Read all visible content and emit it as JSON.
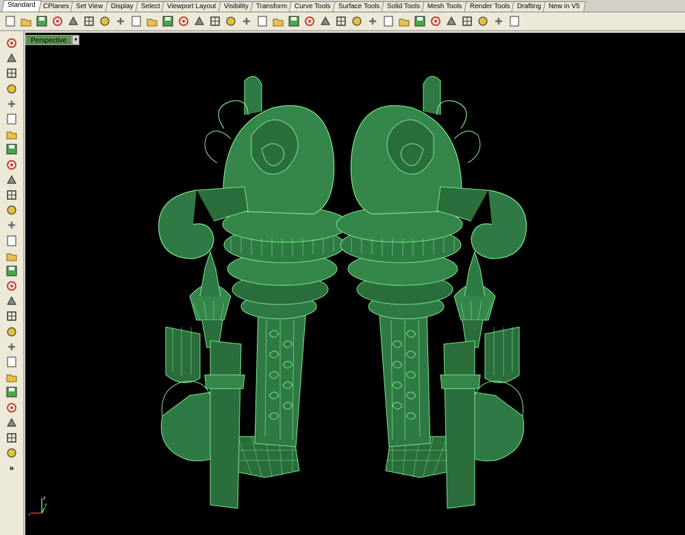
{
  "tabs": [
    {
      "label": "Standard",
      "active": true
    },
    {
      "label": "CPlanes"
    },
    {
      "label": "Set View"
    },
    {
      "label": "Display"
    },
    {
      "label": "Select"
    },
    {
      "label": "Viewport Layout"
    },
    {
      "label": "Visibility"
    },
    {
      "label": "Transform"
    },
    {
      "label": "Curve Tools"
    },
    {
      "label": "Surface Tools"
    },
    {
      "label": "Solid Tools"
    },
    {
      "label": "Mesh Tools"
    },
    {
      "label": "Render Tools"
    },
    {
      "label": "Drafting"
    },
    {
      "label": "New in V5"
    }
  ],
  "toolbar_icons": [
    "new-icon",
    "open-icon",
    "save-icon",
    "print-icon",
    "import-icon",
    "cut-icon",
    "copy-icon",
    "paste-icon",
    "undo-icon",
    "pan-icon",
    "move-view-icon",
    "zoom-icon",
    "zoom-window-icon",
    "zoom-extents-icon",
    "zoom-selected-icon",
    "rotate-view-icon",
    "four-viewports-icon",
    "car-icon",
    "camera-icon",
    "zoom-dynamic-icon",
    "lock-icon",
    "light-bulb-icon",
    "padlock-icon",
    "layer-icon",
    "color-wheel-icon",
    "sphere-gray-icon",
    "sphere-shaded-icon",
    "sphere-render-icon",
    "sphere-blue-icon",
    "render-icon",
    "gear-icon",
    "dimension-icon",
    "help-icon"
  ],
  "left_icons": [
    "select-arrow-icon",
    "point-icon",
    "polyline-icon",
    "curve-icon",
    "circle-icon",
    "ellipse-icon",
    "arc-icon",
    "rectangle-icon",
    "polygon-icon",
    "fillet-icon",
    "surface-icon",
    "extrude-icon",
    "box-icon",
    "sphere-boolean-icon",
    "cylinder-icon",
    "mesh-icon",
    "gear-explode-icon",
    "transform-icon",
    "split-icon",
    "shade-icon",
    "point-cloud-icon",
    "rotate-icon",
    "rebuild-icon",
    "text-icon",
    "array-icon",
    "group-icon",
    "analyze-icon",
    "cube-view-icon"
  ],
  "more_label": "»",
  "viewport": {
    "title": "Perspective"
  },
  "axis_labels": {
    "x": "x",
    "y": "y",
    "z": "z"
  },
  "colors": {
    "model_fill": "#2e7d45",
    "model_edge": "#8cff9c",
    "background": "#000000"
  }
}
